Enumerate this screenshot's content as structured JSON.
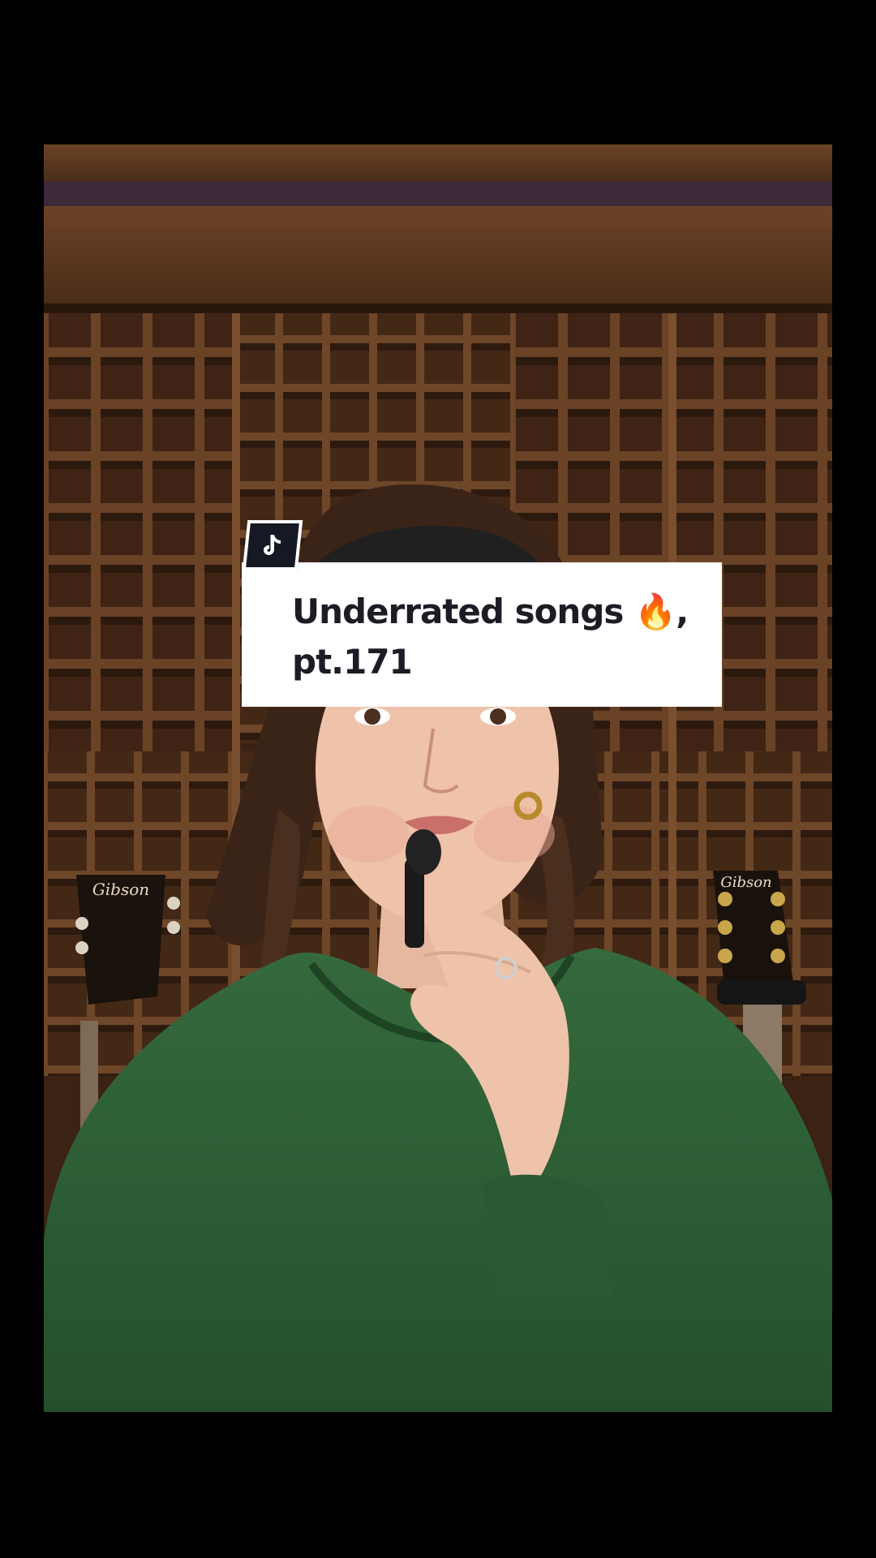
{
  "caption": {
    "line1": "Underrated songs 🔥,",
    "line2": "pt.171"
  },
  "guitar_brand_left": "Gibson",
  "guitar_brand_right": "Gibson",
  "icons": {
    "badge": "tiktok-logo-icon",
    "emoji": "fire-emoji"
  },
  "colors": {
    "background": "#000000",
    "caption_bg": "#ffffff",
    "caption_text": "#1c1c24",
    "badge_bg": "#161823",
    "sweater": "#2c5a33",
    "wood": "#5a3720"
  }
}
